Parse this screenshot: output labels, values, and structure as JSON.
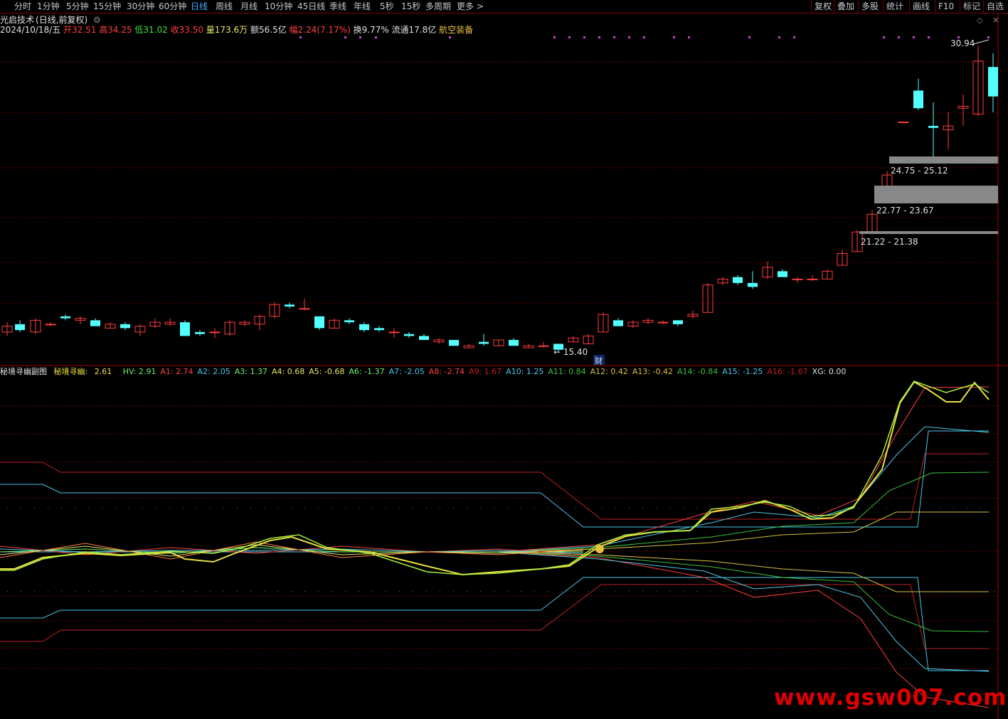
{
  "toolbar": {
    "periods": [
      "分时",
      "1分钟",
      "5分钟",
      "15分钟",
      "30分钟",
      "60分钟",
      "日线",
      "周线",
      "月线",
      "10分钟",
      "45日线",
      "季线",
      "年线",
      "5秒",
      "15秒",
      "多周期",
      "更多 >"
    ],
    "active_period": "日线",
    "right_buttons": [
      "复权",
      "叠加",
      "多股",
      "统计",
      "画线",
      "F10",
      "标记",
      "自选"
    ]
  },
  "title": {
    "name": "光启技术",
    "suffix": "(日线,前复权)"
  },
  "info": {
    "date": "2024/10/18/五",
    "open": "开32.51",
    "high": "高34.25",
    "low": "低31.02",
    "close": "收33.50",
    "volume": "量173.6万",
    "amount": "额56.5亿",
    "change": "幅2.24(7.17%)",
    "turnover": "换9.77%",
    "float": "流通17.8亿",
    "sector": "航空装备"
  },
  "price_labels": {
    "high_mark": "30.94",
    "low_mark": "15.40",
    "zone1": "24.75 - 25.12",
    "zone2": "22.77 - 23.67",
    "zone3": "21.22 - 21.38",
    "cai": "财"
  },
  "indicator": {
    "name": "秘境寻幽副图",
    "main_label": "秘境寻幽:",
    "main_value": "2.61",
    "items": [
      {
        "label": "HV: 2.91",
        "color": "#6cf06c"
      },
      {
        "label": "A1: 2.74",
        "color": "#ff4040"
      },
      {
        "label": "A2: 2.05",
        "color": "#4ac8e8"
      },
      {
        "label": "A3: 1.37",
        "color": "#6cf06c"
      },
      {
        "label": "A4: 0.68",
        "color": "#e8e86c"
      },
      {
        "label": "A5: -0.68",
        "color": "#e8e86c"
      },
      {
        "label": "A6: -1.37",
        "color": "#6cf06c"
      },
      {
        "label": "A7: -2.05",
        "color": "#4ac8e8"
      },
      {
        "label": "A8: -2.74",
        "color": "#ff4040"
      },
      {
        "label": "A9: 1.67",
        "color": "#c02020"
      },
      {
        "label": "A10: 1.25",
        "color": "#4ac8e8"
      },
      {
        "label": "A11: 0.84",
        "color": "#3cc03c"
      },
      {
        "label": "A12: 0.42",
        "color": "#d8c040"
      },
      {
        "label": "A13: -0.42",
        "color": "#d8c040"
      },
      {
        "label": "A14: -0.84",
        "color": "#3cc03c"
      },
      {
        "label": "A15: -1.25",
        "color": "#4ac8e8"
      },
      {
        "label": "A16: -1.67",
        "color": "#c02020"
      },
      {
        "label": "XG: 0.00",
        "color": "#e0e0e0"
      }
    ]
  },
  "watermark": "www.gsw007.com",
  "colors": {
    "up": "#ff3c3c",
    "down": "#54ffff",
    "grid": "#7a0000",
    "marker": "#d040d0"
  }
}
